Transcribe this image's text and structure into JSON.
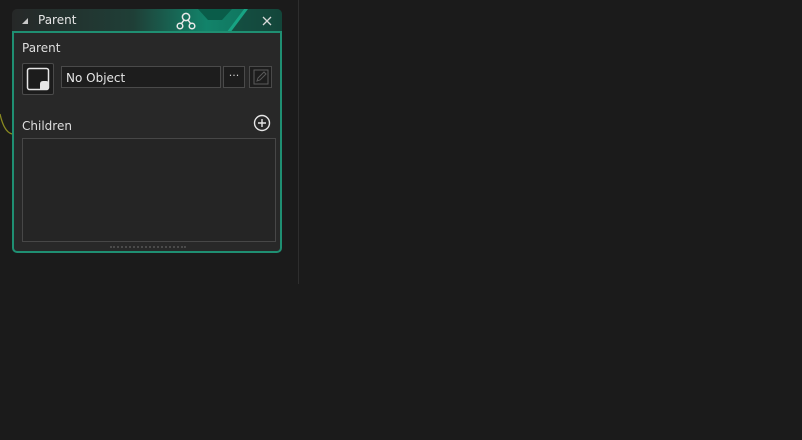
{
  "panel": {
    "title": "Parent",
    "parent_section": {
      "label": "Parent",
      "object_value": "No Object",
      "browse_label": "···"
    },
    "children_section": {
      "label": "Children"
    }
  },
  "icons": {
    "collapse": "collapse-arrow-icon",
    "parent": "parent-hierarchy-icon",
    "close": "close-icon",
    "sprite": "sprite-icon",
    "edit": "edit-icon",
    "add": "add-circle-icon"
  },
  "colors": {
    "accent": "#1f8f72",
    "background": "#1b1b1b",
    "panel_bg": "#282828"
  }
}
